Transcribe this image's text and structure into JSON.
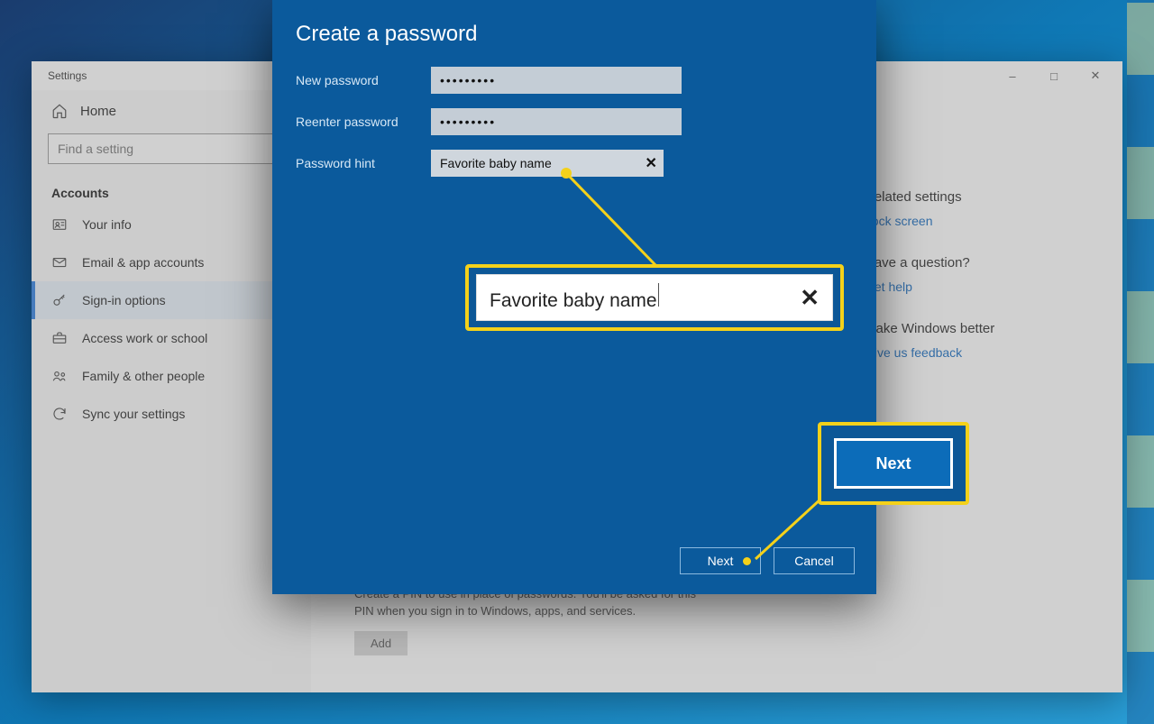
{
  "settings_window": {
    "title": "Settings",
    "home_label": "Home",
    "search_placeholder": "Find a setting",
    "section": "Accounts",
    "nav": {
      "your_info": "Your info",
      "email": "Email & app accounts",
      "sign_in": "Sign-in options",
      "work_school": "Access work or school",
      "family": "Family & other people",
      "sync": "Sync your settings"
    },
    "pin_text": "Create a PIN to use in place of passwords. You'll be asked for this PIN when you sign in to Windows, apps, and services.",
    "add_label": "Add"
  },
  "side_panel": {
    "related_heading": "Related settings",
    "lock_screen": "Lock screen",
    "question_heading": "Have a question?",
    "get_help": "Get help",
    "better_heading": "Make Windows better",
    "feedback": "Give us feedback"
  },
  "dialog": {
    "title": "Create a password",
    "new_pass_label": "New password",
    "reenter_label": "Reenter password",
    "hint_label": "Password hint",
    "pass_value": "•••••••••",
    "hint_value": "Favorite baby name",
    "next": "Next",
    "cancel": "Cancel"
  },
  "callouts": {
    "hint_zoom": "Favorite baby name",
    "next_zoom": "Next"
  }
}
